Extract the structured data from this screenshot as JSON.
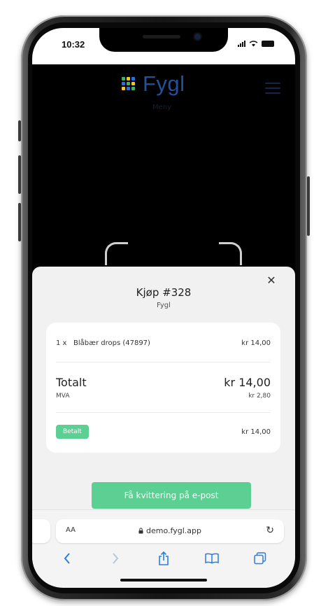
{
  "status_bar": {
    "time": "10:32"
  },
  "app": {
    "brand": "Fygl",
    "subtitle": "Meny"
  },
  "sheet": {
    "title": "Kjøp #328",
    "subtitle": "Fygl",
    "line_item": {
      "qty": "1 x",
      "name": "Blåbær drops (47897)",
      "price": "kr 14,00"
    },
    "total": {
      "label": "Totalt",
      "value": "kr 14,00"
    },
    "vat": {
      "label": "MVA",
      "value": "kr 2,80"
    },
    "paid": {
      "badge": "Betalt",
      "value": "kr 14,00"
    },
    "receipt_button": "Få kvittering på e-post"
  },
  "browser": {
    "aa_label": "AA",
    "url": "demo.fygl.app"
  },
  "colors": {
    "accent_green": "#5ccf93",
    "brand_blue": "#264f9a"
  }
}
